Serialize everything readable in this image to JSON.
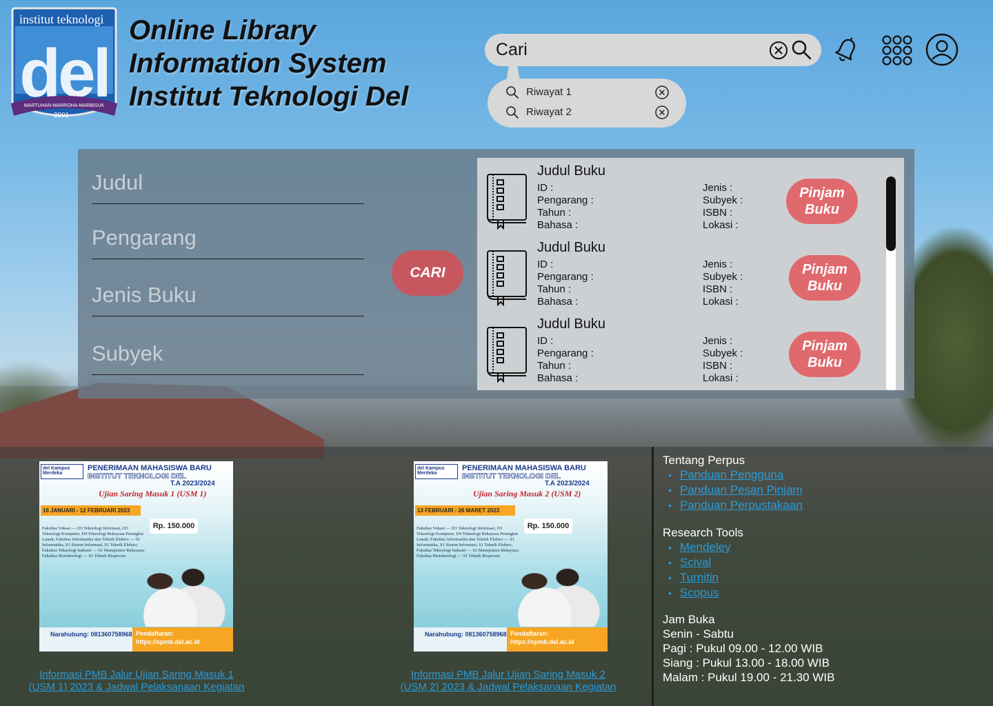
{
  "brand": {
    "logo_top": "institut teknologi",
    "logo_word": "del",
    "logo_motto": "MARTUHAN-MARROHA-MARBISUK",
    "logo_year": "2001",
    "title_lines": [
      "Online Library",
      "Information System",
      "Institut Teknologi Del"
    ]
  },
  "search": {
    "placeholder": "Cari",
    "history": [
      {
        "label": "Riwayat 1"
      },
      {
        "label": "Riwayat 2"
      }
    ]
  },
  "filters": {
    "judul_placeholder": "Judul",
    "pengarang_placeholder": "Pengarang",
    "jenis_placeholder": "Jenis Buku",
    "subyek_placeholder": "Subyek",
    "submit_label": "CARI"
  },
  "results": [
    {
      "title": "Judul Buku",
      "left": [
        "ID :",
        "Pengarang :",
        "Tahun :",
        "Bahasa :"
      ],
      "right": [
        "Jenis :",
        "Subyek :",
        "ISBN :",
        "Lokasi :"
      ],
      "action": [
        "Pinjam",
        "Buku"
      ]
    },
    {
      "title": "Judul Buku",
      "left": [
        "ID :",
        "Pengarang :",
        "Tahun :",
        "Bahasa :"
      ],
      "right": [
        "Jenis :",
        "Subyek :",
        "ISBN :",
        "Lokasi :"
      ],
      "action": [
        "Pinjam",
        "Buku"
      ]
    },
    {
      "title": "Judul Buku",
      "left": [
        "ID :",
        "Pengarang :",
        "Tahun :",
        "Bahasa :"
      ],
      "right": [
        "Jenis :",
        "Subyek :",
        "ISBN :",
        "Lokasi :"
      ],
      "action": [
        "Pinjam",
        "Buku"
      ]
    }
  ],
  "news": [
    {
      "poster": {
        "logo": "del Kampus Merdeka",
        "head1": "PENERIMAAN MAHASISWA BARU",
        "head2": "INSTITUT TEKNOLOGI DEL",
        "head3": "T.A 2023/2024",
        "usm": "Ujian Saring Masuk 1 (USM 1)",
        "date": "16 JANUARI - 12 FEBRUARI 2023",
        "fee": "Rp. 150.000",
        "text": "Fakultas Vokasi — D3 Teknologi Informasi, D3 Teknologi Komputer, D4 Teknologi Rekayasa Perangkat Lunak; Fakultas Informatika dan Teknik Elektro — S1 Informatika, S1 Sistem Informasi, S1 Teknik Elektro; Fakultas Teknologi Industri — S1 Manajemen Rekayasa; Fakultas Bioteknologi — S1 Teknik Bioproses",
        "contact": "Narahubung: 081360758968",
        "reg": "Pendaftaran: https://spmb.del.ac.id"
      },
      "link_lines": [
        "Informasi PMB Jalur Ujian Saring Masuk 1",
        "(USM 1) 2023 & Jadwal Pelaksanaan Kegiatan"
      ]
    },
    {
      "poster": {
        "logo": "del Kampus Merdeka",
        "head1": "PENERIMAAN MAHASISWA BARU",
        "head2": "INSTITUT TEKNOLOGI DEL",
        "head3": "T.A 2023/2024",
        "usm": "Ujian Saring Masuk 2 (USM 2)",
        "date": "13 FEBRUARI - 26 MARET 2023",
        "fee": "Rp. 150.000",
        "text": "Fakultas Vokasi — D3 Teknologi Informasi, D3 Teknologi Komputer, D4 Teknologi Rekayasa Perangkat Lunak; Fakultas Informatika dan Teknik Elektro — S1 Informatika, S1 Sistem Informasi, S1 Teknik Elektro; Fakultas Teknologi Industri — S1 Manajemen Rekayasa; Fakultas Bioteknologi — S1 Teknik Bioproses",
        "contact": "Narahubung: 081360758968",
        "reg": "Pendaftaran: https://spmb.del.ac.id"
      },
      "link_lines": [
        "Informasi PMB Jalur Ujian Saring Masuk 2",
        "(USM 2) 2023 & Jadwal Pelaksanaan Kegiatan"
      ]
    }
  ],
  "footer": {
    "about_heading": "Tentang Perpus",
    "about_links": [
      "Panduan Pengguna",
      "Panduan Pesan Pinjam",
      "Panduan Perpustakaan"
    ],
    "tools_heading": "Research Tools",
    "tools_links": [
      "Mendeley",
      "Scival",
      "Turnitin",
      "Scopus"
    ],
    "hours_heading": "Jam Buka",
    "hours": [
      "Senin - Sabtu",
      "Pagi : Pukul 09.00 - 12.00 WIB",
      "Siang : Pukul 13.00 - 18.00 WIB",
      "Malam : Pukul 19.00 - 21.30 WIB"
    ]
  },
  "colors": {
    "accent_red": "#c7575f",
    "button_red": "#e0696e",
    "link_blue": "#2a9bd9",
    "logo_blue": "#1d5fb0"
  }
}
